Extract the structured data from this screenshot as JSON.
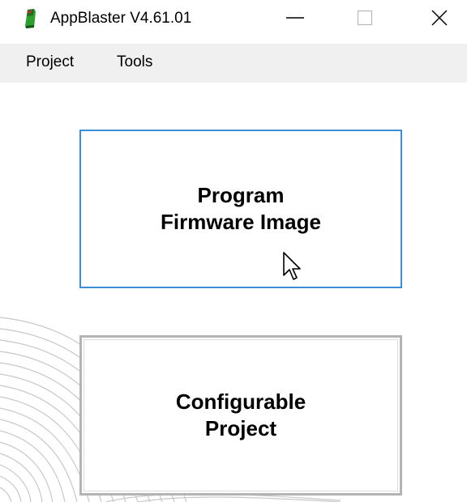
{
  "window": {
    "title": "AppBlaster V4.61.01",
    "controls": {
      "minimize": "minimize-icon",
      "maximize": "maximize-icon",
      "close": "close-icon"
    }
  },
  "menubar": {
    "items": [
      {
        "label": "Project"
      },
      {
        "label": "Tools"
      }
    ]
  },
  "main": {
    "buttons": [
      {
        "line1": "Program",
        "line2": "Firmware Image"
      },
      {
        "line1": "Configurable",
        "line2": "Project"
      }
    ]
  },
  "colors": {
    "focus_border": "#3c8fd6",
    "button_border": "#b4b4b4",
    "menubar_bg": "#f0f0f0",
    "icon_green": "#2e9e2e",
    "icon_red": "#c0302a"
  }
}
